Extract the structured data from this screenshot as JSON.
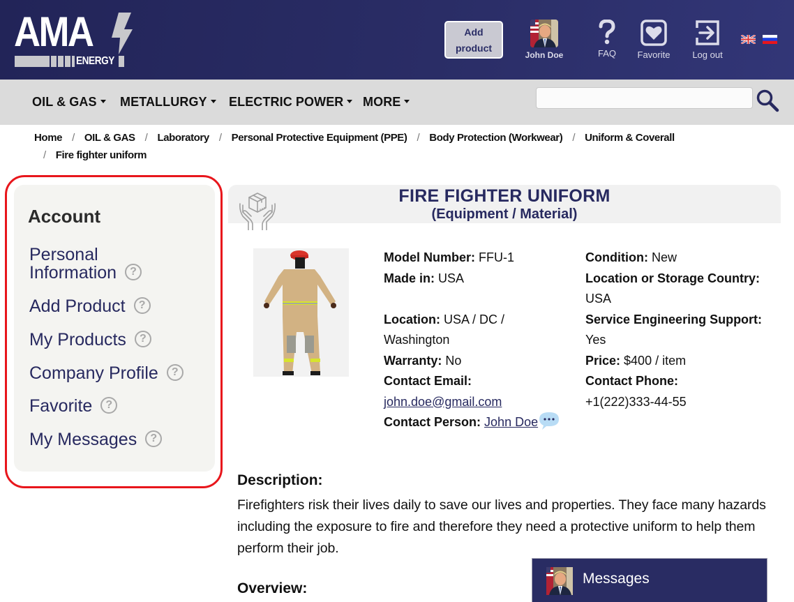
{
  "header": {
    "logo_main": "AMA",
    "logo_sub": "ENERGY",
    "add_product_line1": "Add",
    "add_product_line2": "product",
    "user_name": "John Doe",
    "faq_label": "FAQ",
    "favorite_label": "Favorite",
    "logout_label": "Log out",
    "languages": [
      "English",
      "Russian"
    ],
    "icons": {
      "faq": "question-mark-icon",
      "favorite": "heart-icon",
      "logout": "sign-out-icon"
    }
  },
  "nav": {
    "items": [
      {
        "label": "OIL & GAS"
      },
      {
        "label": "METALLURGY"
      },
      {
        "label": "ELECTRIC POWER"
      },
      {
        "label": "MORE"
      }
    ],
    "search": {
      "value": "",
      "placeholder": ""
    }
  },
  "breadcrumb": {
    "items": [
      "Home",
      "OIL & GAS",
      "Laboratory",
      "Personal Protective Equipment (PPE)",
      "Body Protection (Workwear)",
      "Uniform & Coverall",
      "Fire fighter uniform"
    ]
  },
  "sidebar": {
    "title": "Account",
    "items": [
      {
        "label_line1": "Personal",
        "label_line2": "Information"
      },
      {
        "label": "Add Product"
      },
      {
        "label": "My Products"
      },
      {
        "label": "Company Profile"
      },
      {
        "label": "Favorite"
      },
      {
        "label": "My Messages"
      }
    ],
    "help_glyph": "?"
  },
  "product": {
    "title": "FIRE FIGHTER UNIFORM",
    "subtitle": "(Equipment / Material)",
    "image_alt": "Fire fighter uniform",
    "left": {
      "model_label": "Model Number:",
      "model_value": " FFU-1",
      "made_label": "Made in:",
      "made_value": " USA",
      "location_label": "Location:",
      "location_value1": " USA / DC /",
      "location_value2": "Washington",
      "warranty_label": "Warranty:",
      "warranty_value": " No",
      "email_label": "Contact Email:",
      "email_value": "john.doe@gmail.com",
      "person_label": "Contact Person:",
      "person_value": "John Doe"
    },
    "right": {
      "condition_label": "Condition:",
      "condition_value": " New",
      "storage_label": "Location or Storage Country:",
      "storage_value": "USA",
      "support_label": "Service Engineering Support:",
      "support_value": "Yes",
      "price_label": "Price:",
      "price_value": " $400 / item",
      "phone_label": "Contact Phone:",
      "phone_value": "+1(222)333-44-55"
    },
    "description_heading": "Description:",
    "description": "Firefighters risk their lives daily to save our lives and properties. They face many hazards including the exposure to fire and therefore they need a protective uniform to help them perform their job.",
    "overview_heading": "Overview:"
  },
  "messages_panel": {
    "label": "Messages"
  },
  "colors": {
    "brand_navy": "#27295f",
    "header_bg": "#2a2d66",
    "nav_bg": "#dbdbdb",
    "highlight_red": "#e8161c",
    "sidebar_bg": "#f4f4f1"
  }
}
